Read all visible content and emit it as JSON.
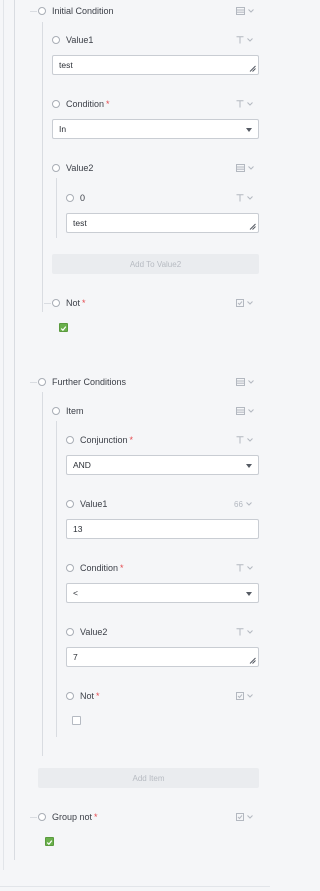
{
  "initial_condition": {
    "label": "Initial Condition",
    "value1": {
      "label": "Value1",
      "value": "test"
    },
    "condition": {
      "label": "Condition",
      "required": "*",
      "value": "In"
    },
    "value2": {
      "label": "Value2",
      "item0": {
        "label": "0",
        "value": "test"
      },
      "add_button": "Add To Value2"
    },
    "not": {
      "label": "Not",
      "required": "*",
      "checked": true
    }
  },
  "further_conditions": {
    "label": "Further Conditions",
    "item": {
      "label": "Item",
      "conjunction": {
        "label": "Conjunction",
        "required": "*",
        "value": "AND"
      },
      "value1": {
        "label": "Value1",
        "value": "13",
        "type_badge": "66"
      },
      "condition": {
        "label": "Condition",
        "required": "*",
        "value": "<"
      },
      "value2": {
        "label": "Value2",
        "value": "7"
      },
      "not": {
        "label": "Not",
        "required": "*",
        "checked": false
      }
    },
    "add_button": "Add Item"
  },
  "group_not": {
    "label": "Group not",
    "required": "*",
    "checked": true
  },
  "icons": {
    "text_type": "text-type-icon",
    "list_type": "list-type-icon",
    "bool_type": "checkbox-type-icon",
    "number_type": "number-type-icon",
    "caret": "chevron-down-icon"
  },
  "colors": {
    "check_on": "#6ab04c",
    "required": "#e5484d",
    "background": "#f5f6f8"
  }
}
